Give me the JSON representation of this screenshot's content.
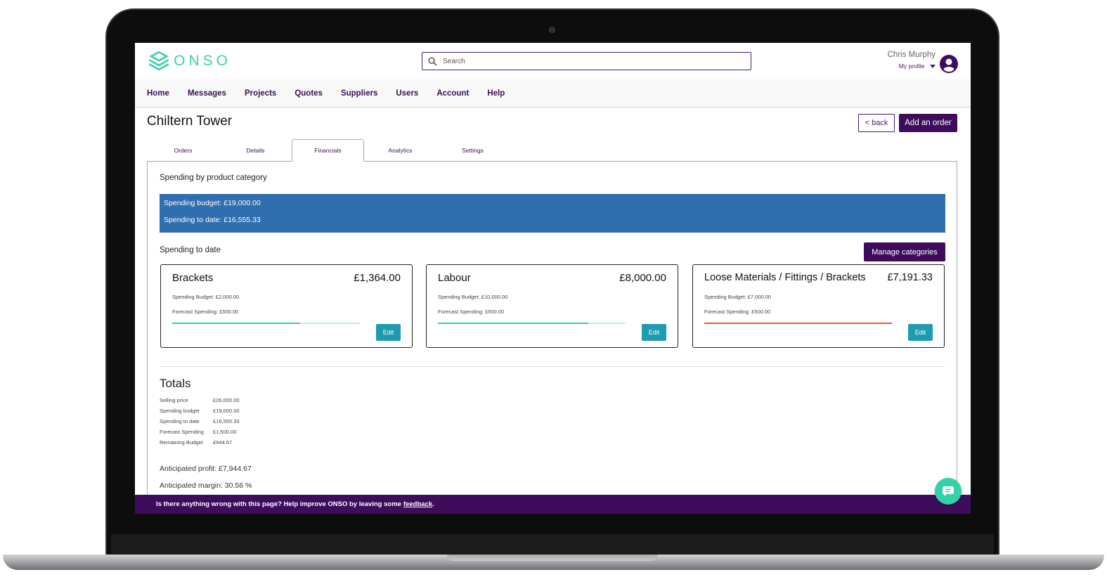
{
  "app": {
    "logo_text": "ONSO",
    "brand_color": "#3d0d5c",
    "accent_color": "#3ed0ae"
  },
  "header": {
    "search_placeholder": "Search",
    "user_name": "Chris Murphy",
    "profile_label": "My profile"
  },
  "nav": {
    "items": [
      {
        "label": "Home"
      },
      {
        "label": "Messages"
      },
      {
        "label": "Projects"
      },
      {
        "label": "Quotes"
      },
      {
        "label": "Suppliers"
      },
      {
        "label": "Users"
      },
      {
        "label": "Account"
      },
      {
        "label": "Help"
      }
    ]
  },
  "page": {
    "title": "Chiltern Tower",
    "back_label": "< back",
    "add_order_label": "Add an order"
  },
  "tabs": [
    {
      "label": "Orders",
      "active": false
    },
    {
      "label": "Details",
      "active": false
    },
    {
      "label": "Financials",
      "active": true
    },
    {
      "label": "Analytics",
      "active": false
    },
    {
      "label": "Settings",
      "active": false
    }
  ],
  "financials": {
    "section_title": "Spending by product category",
    "budget_line": "Spending budget: £19,000.00",
    "todate_line": "Spending to date: £16,555.33",
    "spending_to_date_title": "Spending to date",
    "manage_label": "Manage categories",
    "categories": [
      {
        "name": "Brackets",
        "amount": "£1,364.00",
        "budget": "Spending Budget: £2,000.00",
        "forecast": "Forecast Spending: £500.00",
        "progress": 0.68,
        "status": "ok",
        "edit_label": "Edit"
      },
      {
        "name": "Labour",
        "amount": "£8,000.00",
        "budget": "Spending Budget: £10,000.00",
        "forecast": "Forecast Spending: £500.00",
        "progress": 0.8,
        "status": "ok",
        "edit_label": "Edit"
      },
      {
        "name": "Loose Materials / Fittings / Brackets",
        "amount": "£7,191.33",
        "budget": "Spending Budget: £7,000.00",
        "forecast": "Forecast Spending: £500.00",
        "progress": 1.0,
        "status": "over",
        "edit_label": "Edit"
      }
    ],
    "status_colors": {
      "ok": "#2bcfa8",
      "over": "#f05a28"
    }
  },
  "totals": {
    "title": "Totals",
    "rows": [
      {
        "label": "Selling price",
        "value": "£26,000.00"
      },
      {
        "label": "Spending budget",
        "value": "£19,000.00"
      },
      {
        "label": "Spending to date",
        "value": "£16,555.33"
      },
      {
        "label": "Forecast Spending",
        "value": "£1,500.00"
      },
      {
        "label": "Remaining Budget",
        "value": "£944.67"
      }
    ],
    "profit": "Anticipated profit: £7,944.67",
    "margin": "Anticipated margin: 30.56 %"
  },
  "feedback": {
    "text": "Is there anything wrong with this page? Help improve ONSO by leaving some",
    "link_label": "feedback",
    "suffix": "."
  },
  "icons": {
    "search": "search-icon",
    "avatar": "user-circle-icon",
    "caret": "caret-down-icon",
    "chat": "chat-icon",
    "logo": "onso-logo-icon"
  }
}
